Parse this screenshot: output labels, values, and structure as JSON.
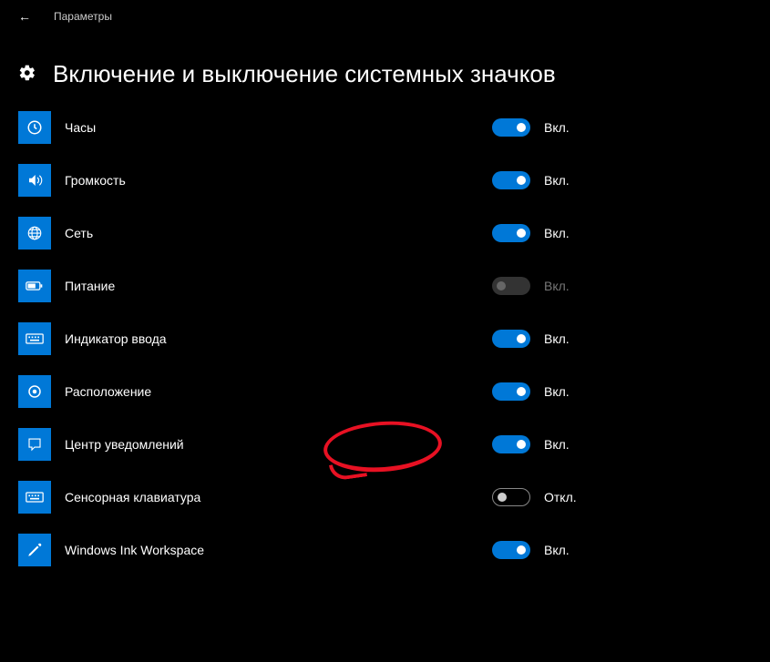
{
  "app_title": "Параметры",
  "page_title": "Включение и выключение системных значков",
  "labels": {
    "on": "Вкл.",
    "off": "Откл."
  },
  "items": [
    {
      "id": "clock",
      "label": "Часы",
      "icon": "clock",
      "state": "on"
    },
    {
      "id": "volume",
      "label": "Громкость",
      "icon": "volume",
      "state": "on"
    },
    {
      "id": "network",
      "label": "Сеть",
      "icon": "network",
      "state": "on"
    },
    {
      "id": "power",
      "label": "Питание",
      "icon": "power",
      "state": "disabled"
    },
    {
      "id": "input",
      "label": "Индикатор ввода",
      "icon": "keyboard",
      "state": "on"
    },
    {
      "id": "location",
      "label": "Расположение",
      "icon": "location",
      "state": "on"
    },
    {
      "id": "action",
      "label": "Центр уведомлений",
      "icon": "action",
      "state": "on"
    },
    {
      "id": "touchkb",
      "label": "Сенсорная клавиатура",
      "icon": "keyboard",
      "state": "off"
    },
    {
      "id": "ink",
      "label": "Windows Ink Workspace",
      "icon": "ink",
      "state": "on"
    }
  ]
}
